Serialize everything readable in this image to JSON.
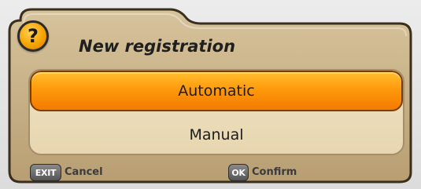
{
  "dialog": {
    "title": "New registration",
    "help_glyph": "?",
    "icon": "help-question-icon"
  },
  "options": [
    {
      "label": "Automatic",
      "selected": true
    },
    {
      "label": "Manual",
      "selected": false
    }
  ],
  "footer": {
    "exit_key": "EXIT",
    "cancel_label": "Cancel",
    "ok_key": "OK",
    "confirm_label": "Confirm"
  },
  "colors": {
    "selected_accent": "#f7940a",
    "panel_bg": "#efe2c3",
    "dialog_bg": "#c9b28a"
  }
}
